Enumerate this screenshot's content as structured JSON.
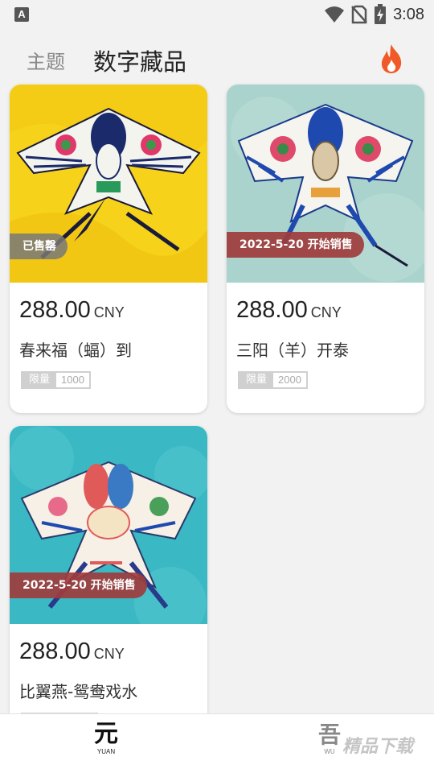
{
  "status_bar": {
    "time": "3:08",
    "notif_letter": "A"
  },
  "header": {
    "tab_theme": "主题",
    "tab_digital": "数字藏品"
  },
  "cards": [
    {
      "badge": "已售罄",
      "badge_type": "sold",
      "price": "288.00",
      "currency": "CNY",
      "title": "春来福（蝠）到",
      "limit_label": "限量",
      "limit_value": "1000"
    },
    {
      "badge": "2022-5-20 开始销售",
      "badge_type": "sale",
      "price": "288.00",
      "currency": "CNY",
      "title": "三阳（羊）开泰",
      "limit_label": "限量",
      "limit_value": "2000"
    },
    {
      "badge": "2022-5-20 开始销售",
      "badge_type": "sale",
      "price": "288.00",
      "currency": "CNY",
      "title": "比翼燕-鸳鸯戏水"
    }
  ],
  "bottom_nav": {
    "yuan_glyph": "元",
    "yuan_sub": "YUAN",
    "wu_glyph": "吾",
    "wu_sub": "WU"
  },
  "watermark": "精品下载",
  "colors": {
    "sale_badge": "#a03c3c",
    "sold_badge": "#787878",
    "fire": "#f05a28"
  }
}
